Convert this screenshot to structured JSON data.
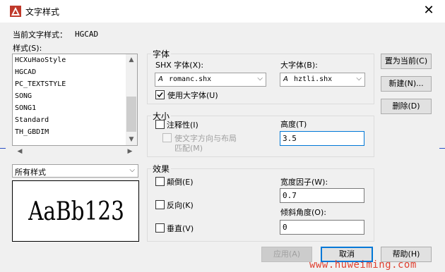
{
  "window": {
    "title": "文字样式",
    "close_glyph": "✕"
  },
  "current_style": {
    "label": "当前文字样式：",
    "value": "HGCAD"
  },
  "styles": {
    "label": "样式(S):",
    "items": [
      "HCXuHaoStyle",
      "HGCAD",
      "PC_TEXTSTYLE",
      "SONG",
      "SONG1",
      "Standard",
      "TH_GBDIM"
    ],
    "filter_value": "所有样式"
  },
  "preview": {
    "text": "AaBb123"
  },
  "font_group": {
    "title": "字体",
    "shx_label": "SHX 字体(X):",
    "shx_value": "romanc.shx",
    "bigfont_label": "大字体(B):",
    "bigfont_value": "hztli.shx",
    "use_bigfont_label": "使用大字体(U)",
    "use_bigfont_checked": true,
    "file_glyph": "A"
  },
  "size_group": {
    "title": "大小",
    "annotative_label": "注释性(I)",
    "annotative_checked": false,
    "match_orientation_label_1": "使文字方向与布局",
    "match_orientation_label_2": "匹配(M)",
    "height_label": "高度(T)",
    "height_value": "3.5"
  },
  "effects_group": {
    "title": "效果",
    "upside_down_label": "颠倒(E)",
    "backwards_label": "反向(K)",
    "vertical_label": "垂直(V)",
    "width_factor_label": "宽度因子(W):",
    "width_factor_value": "0.7",
    "oblique_label": "倾斜角度(O):",
    "oblique_value": "0"
  },
  "buttons": {
    "set_current": "置为当前(C)",
    "new": "新建(N)...",
    "delete": "删除(D)",
    "apply": "应用(A)",
    "cancel": "取消",
    "help": "帮助(H)"
  },
  "watermark": "www.huweiming.com",
  "colors": {
    "accent": "#0078d7",
    "app_icon": "#c0392b",
    "watermark": "#e04030"
  }
}
